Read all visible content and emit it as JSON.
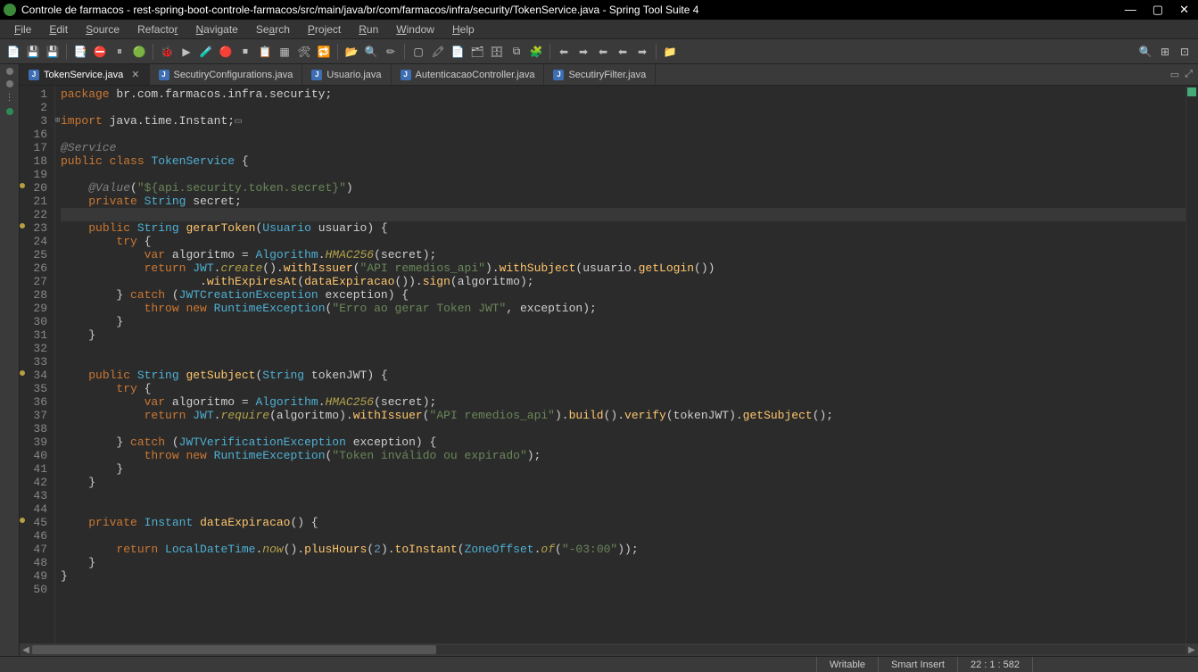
{
  "window": {
    "title": "Controle de farmacos - rest-spring-boot-controle-farmacos/src/main/java/br/com/farmacos/infra/security/TokenService.java - Spring Tool Suite 4"
  },
  "menu": {
    "items": [
      {
        "label": "File",
        "u": 0
      },
      {
        "label": "Edit",
        "u": 0
      },
      {
        "label": "Source",
        "u": 0
      },
      {
        "label": "Refactor",
        "u": 7
      },
      {
        "label": "Navigate",
        "u": 0
      },
      {
        "label": "Search",
        "u": 2
      },
      {
        "label": "Project",
        "u": 0
      },
      {
        "label": "Run",
        "u": 0
      },
      {
        "label": "Window",
        "u": 0
      },
      {
        "label": "Help",
        "u": 0
      }
    ]
  },
  "toolbar": {
    "groups": [
      [
        "📄",
        "💾",
        "💾*"
      ],
      [
        "📑",
        "⛔",
        "⏸",
        "🟢"
      ],
      [
        "🐞",
        "▶",
        "🧪",
        "🔴",
        "⏹",
        "📋",
        "▦",
        "🛠",
        "🔁"
      ],
      [
        "📂",
        "🔍",
        "✏"
      ],
      [
        "▢",
        "🖍",
        "📄",
        "🗂",
        "🗄",
        "⧉",
        "🧩"
      ],
      [
        "⬅",
        "➡",
        "⬅*",
        "⬅",
        "➡"
      ],
      [
        "📁"
      ]
    ],
    "right": [
      "🔍",
      "⊞",
      "⊡"
    ]
  },
  "tabs": [
    {
      "label": "TokenService.java",
      "active": true,
      "close": true
    },
    {
      "label": "SecutiryConfigurations.java",
      "active": false
    },
    {
      "label": "Usuario.java",
      "active": false
    },
    {
      "label": "AutenticacaoController.java",
      "active": false
    },
    {
      "label": "SecutiryFilter.java",
      "active": false
    }
  ],
  "editor": {
    "filename": "TokenService.java",
    "current_line": 22,
    "lines": [
      {
        "n": 1,
        "seg": [
          [
            "kw",
            "package"
          ],
          [
            "punct",
            " "
          ],
          [
            "pkg",
            "br.com.farmacos.infra.security"
          ],
          [
            "punct",
            ";"
          ]
        ]
      },
      {
        "n": 2,
        "seg": []
      },
      {
        "n": 3,
        "fold": true,
        "seg": [
          [
            "kw",
            "import"
          ],
          [
            "punct",
            " "
          ],
          [
            "pkg",
            "java.time.Instant"
          ],
          [
            "punct",
            ";"
          ],
          [
            "ann-c",
            "▭"
          ]
        ]
      },
      {
        "n": 16,
        "seg": []
      },
      {
        "n": 17,
        "seg": [
          [
            "ann-c",
            "@Service"
          ]
        ]
      },
      {
        "n": 18,
        "seg": [
          [
            "kw",
            "public"
          ],
          [
            "punct",
            " "
          ],
          [
            "kw",
            "class"
          ],
          [
            "punct",
            " "
          ],
          [
            "cls",
            "TokenService"
          ],
          [
            "punct",
            " {"
          ]
        ]
      },
      {
        "n": 19,
        "seg": []
      },
      {
        "n": 20,
        "ann": "warn",
        "seg": [
          [
            "punct",
            "    "
          ],
          [
            "ann-c",
            "@Value"
          ],
          [
            "punct",
            "("
          ],
          [
            "str",
            "\"${api.security.token.secret}\""
          ],
          [
            "punct",
            ")"
          ]
        ]
      },
      {
        "n": 21,
        "seg": [
          [
            "punct",
            "    "
          ],
          [
            "kw",
            "private"
          ],
          [
            "punct",
            " "
          ],
          [
            "type",
            "String"
          ],
          [
            "punct",
            " "
          ],
          [
            "ident",
            "secret"
          ],
          [
            "punct",
            ";"
          ]
        ]
      },
      {
        "n": 22,
        "hl": true,
        "seg": []
      },
      {
        "n": 23,
        "ann": "warn",
        "seg": [
          [
            "punct",
            "    "
          ],
          [
            "kw",
            "public"
          ],
          [
            "punct",
            " "
          ],
          [
            "type",
            "String"
          ],
          [
            "punct",
            " "
          ],
          [
            "method",
            "gerarToken"
          ],
          [
            "punct",
            "("
          ],
          [
            "type",
            "Usuario"
          ],
          [
            "punct",
            " "
          ],
          [
            "ident",
            "usuario"
          ],
          [
            "punct",
            ") {"
          ]
        ]
      },
      {
        "n": 24,
        "seg": [
          [
            "punct",
            "        "
          ],
          [
            "kw",
            "try"
          ],
          [
            "punct",
            " {"
          ]
        ]
      },
      {
        "n": 25,
        "seg": [
          [
            "punct",
            "            "
          ],
          [
            "kw",
            "var"
          ],
          [
            "punct",
            " "
          ],
          [
            "ident",
            "algoritmo"
          ],
          [
            "punct",
            " = "
          ],
          [
            "type",
            "Algorithm"
          ],
          [
            "punct",
            "."
          ],
          [
            "static-m",
            "HMAC256"
          ],
          [
            "punct",
            "("
          ],
          [
            "ident",
            "secret"
          ],
          [
            "punct",
            ");"
          ]
        ]
      },
      {
        "n": 26,
        "seg": [
          [
            "punct",
            "            "
          ],
          [
            "kw",
            "return"
          ],
          [
            "punct",
            " "
          ],
          [
            "type",
            "JWT"
          ],
          [
            "punct",
            "."
          ],
          [
            "static-m",
            "create"
          ],
          [
            "punct",
            "()."
          ],
          [
            "method",
            "withIssuer"
          ],
          [
            "punct",
            "("
          ],
          [
            "str",
            "\"API remedios_api\""
          ],
          [
            "punct",
            ")."
          ],
          [
            "method",
            "withSubject"
          ],
          [
            "punct",
            "("
          ],
          [
            "ident",
            "usuario"
          ],
          [
            "punct",
            "."
          ],
          [
            "method",
            "getLogin"
          ],
          [
            "punct",
            "())"
          ]
        ]
      },
      {
        "n": 27,
        "seg": [
          [
            "punct",
            "                    ."
          ],
          [
            "method",
            "withExpiresAt"
          ],
          [
            "punct",
            "("
          ],
          [
            "method",
            "dataExpiracao"
          ],
          [
            "punct",
            "())."
          ],
          [
            "method",
            "sign"
          ],
          [
            "punct",
            "("
          ],
          [
            "ident",
            "algoritmo"
          ],
          [
            "punct",
            ");"
          ]
        ]
      },
      {
        "n": 28,
        "seg": [
          [
            "punct",
            "        } "
          ],
          [
            "kw",
            "catch"
          ],
          [
            "punct",
            " ("
          ],
          [
            "type",
            "JWTCreationException"
          ],
          [
            "punct",
            " "
          ],
          [
            "ident",
            "exception"
          ],
          [
            "punct",
            ") {"
          ]
        ]
      },
      {
        "n": 29,
        "seg": [
          [
            "punct",
            "            "
          ],
          [
            "kw",
            "throw"
          ],
          [
            "punct",
            " "
          ],
          [
            "kw",
            "new"
          ],
          [
            "punct",
            " "
          ],
          [
            "type",
            "RuntimeException"
          ],
          [
            "punct",
            "("
          ],
          [
            "str",
            "\"Erro ao gerar Token JWT\""
          ],
          [
            "punct",
            ", "
          ],
          [
            "ident",
            "exception"
          ],
          [
            "punct",
            ");"
          ]
        ]
      },
      {
        "n": 30,
        "seg": [
          [
            "punct",
            "        }"
          ]
        ]
      },
      {
        "n": 31,
        "seg": [
          [
            "punct",
            "    }"
          ]
        ]
      },
      {
        "n": 32,
        "seg": []
      },
      {
        "n": 33,
        "seg": []
      },
      {
        "n": 34,
        "ann": "warn",
        "seg": [
          [
            "punct",
            "    "
          ],
          [
            "kw",
            "public"
          ],
          [
            "punct",
            " "
          ],
          [
            "type",
            "String"
          ],
          [
            "punct",
            " "
          ],
          [
            "method",
            "getSubject"
          ],
          [
            "punct",
            "("
          ],
          [
            "type",
            "String"
          ],
          [
            "punct",
            " "
          ],
          [
            "ident",
            "tokenJWT"
          ],
          [
            "punct",
            ") {"
          ]
        ]
      },
      {
        "n": 35,
        "seg": [
          [
            "punct",
            "        "
          ],
          [
            "kw",
            "try"
          ],
          [
            "punct",
            " {"
          ]
        ]
      },
      {
        "n": 36,
        "seg": [
          [
            "punct",
            "            "
          ],
          [
            "kw",
            "var"
          ],
          [
            "punct",
            " "
          ],
          [
            "ident",
            "algoritmo"
          ],
          [
            "punct",
            " = "
          ],
          [
            "type",
            "Algorithm"
          ],
          [
            "punct",
            "."
          ],
          [
            "static-m",
            "HMAC256"
          ],
          [
            "punct",
            "("
          ],
          [
            "ident",
            "secret"
          ],
          [
            "punct",
            ");"
          ]
        ]
      },
      {
        "n": 37,
        "seg": [
          [
            "punct",
            "            "
          ],
          [
            "kw",
            "return"
          ],
          [
            "punct",
            " "
          ],
          [
            "type",
            "JWT"
          ],
          [
            "punct",
            "."
          ],
          [
            "static-m",
            "require"
          ],
          [
            "punct",
            "("
          ],
          [
            "ident",
            "algoritmo"
          ],
          [
            "punct",
            ")."
          ],
          [
            "method",
            "withIssuer"
          ],
          [
            "punct",
            "("
          ],
          [
            "str",
            "\"API remedios_api\""
          ],
          [
            "punct",
            ")."
          ],
          [
            "method",
            "build"
          ],
          [
            "punct",
            "()."
          ],
          [
            "method",
            "verify"
          ],
          [
            "punct",
            "("
          ],
          [
            "ident",
            "tokenJWT"
          ],
          [
            "punct",
            ")."
          ],
          [
            "method",
            "getSubject"
          ],
          [
            "punct",
            "();"
          ]
        ]
      },
      {
        "n": 38,
        "seg": []
      },
      {
        "n": 39,
        "seg": [
          [
            "punct",
            "        } "
          ],
          [
            "kw",
            "catch"
          ],
          [
            "punct",
            " ("
          ],
          [
            "type",
            "JWTVerificationException"
          ],
          [
            "punct",
            " "
          ],
          [
            "ident",
            "exception"
          ],
          [
            "punct",
            ") {"
          ]
        ]
      },
      {
        "n": 40,
        "seg": [
          [
            "punct",
            "            "
          ],
          [
            "kw",
            "throw"
          ],
          [
            "punct",
            " "
          ],
          [
            "kw",
            "new"
          ],
          [
            "punct",
            " "
          ],
          [
            "type",
            "RuntimeException"
          ],
          [
            "punct",
            "("
          ],
          [
            "str",
            "\"Token inválido ou expirado\""
          ],
          [
            "punct",
            ");"
          ]
        ]
      },
      {
        "n": 41,
        "seg": [
          [
            "punct",
            "        }"
          ]
        ]
      },
      {
        "n": 42,
        "seg": [
          [
            "punct",
            "    }"
          ]
        ]
      },
      {
        "n": 43,
        "seg": []
      },
      {
        "n": 44,
        "seg": []
      },
      {
        "n": 45,
        "ann": "warn",
        "seg": [
          [
            "punct",
            "    "
          ],
          [
            "kw",
            "private"
          ],
          [
            "punct",
            " "
          ],
          [
            "type",
            "Instant"
          ],
          [
            "punct",
            " "
          ],
          [
            "method",
            "dataExpiracao"
          ],
          [
            "punct",
            "() {"
          ]
        ]
      },
      {
        "n": 46,
        "seg": []
      },
      {
        "n": 47,
        "seg": [
          [
            "punct",
            "        "
          ],
          [
            "kw",
            "return"
          ],
          [
            "punct",
            " "
          ],
          [
            "type",
            "LocalDateTime"
          ],
          [
            "punct",
            "."
          ],
          [
            "static-m",
            "now"
          ],
          [
            "punct",
            "()."
          ],
          [
            "method",
            "plusHours"
          ],
          [
            "punct",
            "("
          ],
          [
            "num",
            "2"
          ],
          [
            "punct",
            ")."
          ],
          [
            "method",
            "toInstant"
          ],
          [
            "punct",
            "("
          ],
          [
            "type",
            "ZoneOffset"
          ],
          [
            "punct",
            "."
          ],
          [
            "static-m",
            "of"
          ],
          [
            "punct",
            "("
          ],
          [
            "str",
            "\"-03:00\""
          ],
          [
            "punct",
            "));"
          ]
        ]
      },
      {
        "n": 48,
        "seg": [
          [
            "punct",
            "    }"
          ]
        ]
      },
      {
        "n": 49,
        "seg": [
          [
            "punct",
            "}"
          ]
        ]
      },
      {
        "n": 50,
        "seg": []
      }
    ]
  },
  "status": {
    "writable": "Writable",
    "insert": "Smart Insert",
    "pos": "22 : 1 : 582"
  }
}
